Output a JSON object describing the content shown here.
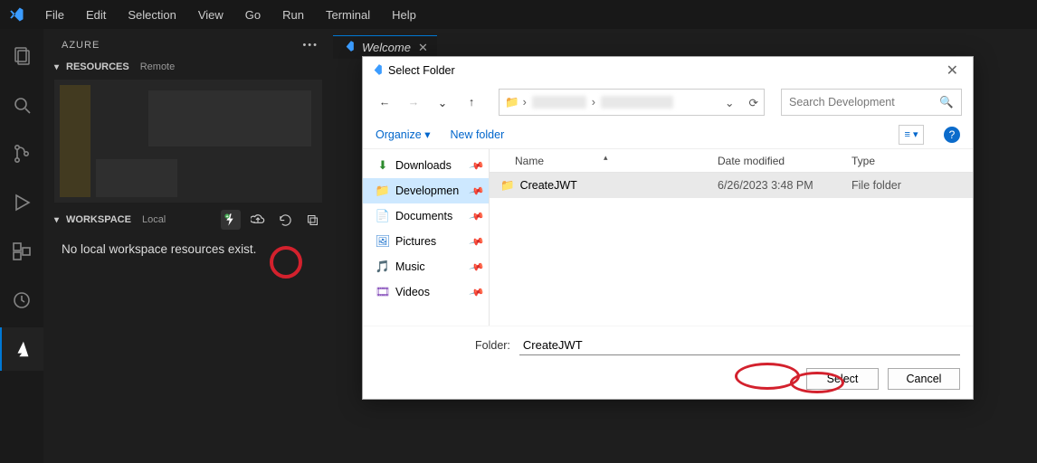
{
  "menu": {
    "items": [
      "File",
      "Edit",
      "Selection",
      "View",
      "Go",
      "Run",
      "Terminal",
      "Help"
    ]
  },
  "panel": {
    "title": "AZURE",
    "resources_label": "RESOURCES",
    "resources_sub": "Remote",
    "workspace_label": "WORKSPACE",
    "workspace_sub": "Local",
    "no_local": "No local workspace resources exist."
  },
  "tab": {
    "welcome": "Welcome"
  },
  "dialog": {
    "title": "Select Folder",
    "organize": "Organize",
    "new_folder": "New folder",
    "search_placeholder": "Search Development",
    "columns": {
      "name": "Name",
      "date": "Date modified",
      "type": "Type"
    },
    "tree": {
      "downloads": "Downloads",
      "development": "Developmen",
      "documents": "Documents",
      "pictures": "Pictures",
      "music": "Music",
      "videos": "Videos"
    },
    "rows": [
      {
        "name": "CreateJWT",
        "date": "6/26/2023 3:48 PM",
        "type": "File folder"
      }
    ],
    "folder_label": "Folder:",
    "folder_value": "CreateJWT",
    "select_btn": "Select",
    "cancel_btn": "Cancel"
  }
}
